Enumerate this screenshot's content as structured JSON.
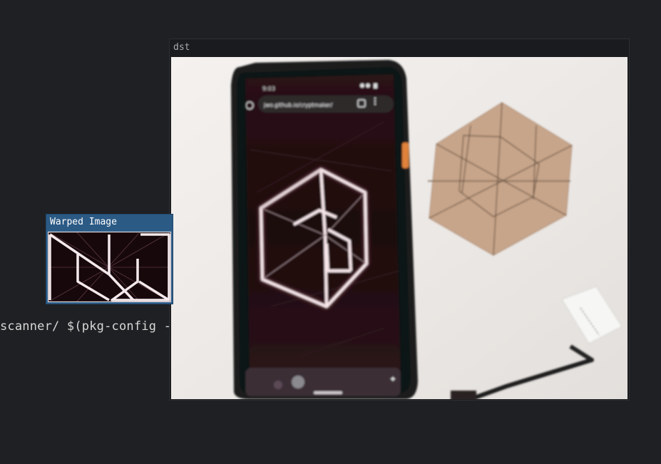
{
  "terminal": {
    "visible_text": "scanner/ $(pkg-config -"
  },
  "windows": {
    "dst": {
      "title": "dst"
    },
    "warped": {
      "title": "Warped Image"
    }
  },
  "phone_screen": {
    "status_time": "9:03",
    "address_bar": "jwo.github.io/cryptmaker/"
  },
  "icons": {
    "phone_home": "home-icon",
    "phone_tabs": "tabs-icon",
    "phone_menu": "kebab-menu-icon",
    "phone_sparkle": "sparkle-icon"
  },
  "colors": {
    "desktop_bg": "#1f2023",
    "terminal_text": "#d8d8d8",
    "warp_titlebar": "#2b5a85",
    "dst_titlebar": "#1a1b1e"
  }
}
